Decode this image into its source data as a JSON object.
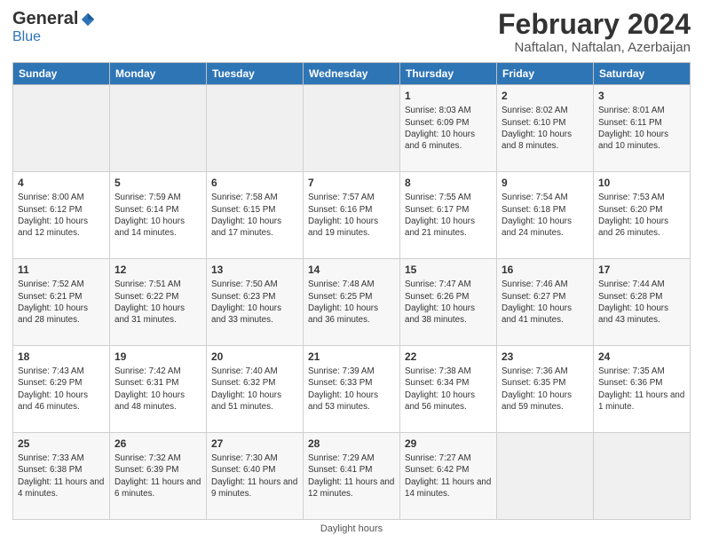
{
  "logo": {
    "general": "General",
    "blue": "Blue"
  },
  "header": {
    "month_year": "February 2024",
    "location": "Naftalan, Naftalan, Azerbaijan"
  },
  "days_of_week": [
    "Sunday",
    "Monday",
    "Tuesday",
    "Wednesday",
    "Thursday",
    "Friday",
    "Saturday"
  ],
  "footer": {
    "label": "Daylight hours"
  },
  "weeks": [
    [
      {
        "day": "",
        "info": ""
      },
      {
        "day": "",
        "info": ""
      },
      {
        "day": "",
        "info": ""
      },
      {
        "day": "",
        "info": ""
      },
      {
        "day": "1",
        "info": "Sunrise: 8:03 AM\nSunset: 6:09 PM\nDaylight: 10 hours and 6 minutes."
      },
      {
        "day": "2",
        "info": "Sunrise: 8:02 AM\nSunset: 6:10 PM\nDaylight: 10 hours and 8 minutes."
      },
      {
        "day": "3",
        "info": "Sunrise: 8:01 AM\nSunset: 6:11 PM\nDaylight: 10 hours and 10 minutes."
      }
    ],
    [
      {
        "day": "4",
        "info": "Sunrise: 8:00 AM\nSunset: 6:12 PM\nDaylight: 10 hours and 12 minutes."
      },
      {
        "day": "5",
        "info": "Sunrise: 7:59 AM\nSunset: 6:14 PM\nDaylight: 10 hours and 14 minutes."
      },
      {
        "day": "6",
        "info": "Sunrise: 7:58 AM\nSunset: 6:15 PM\nDaylight: 10 hours and 17 minutes."
      },
      {
        "day": "7",
        "info": "Sunrise: 7:57 AM\nSunset: 6:16 PM\nDaylight: 10 hours and 19 minutes."
      },
      {
        "day": "8",
        "info": "Sunrise: 7:55 AM\nSunset: 6:17 PM\nDaylight: 10 hours and 21 minutes."
      },
      {
        "day": "9",
        "info": "Sunrise: 7:54 AM\nSunset: 6:18 PM\nDaylight: 10 hours and 24 minutes."
      },
      {
        "day": "10",
        "info": "Sunrise: 7:53 AM\nSunset: 6:20 PM\nDaylight: 10 hours and 26 minutes."
      }
    ],
    [
      {
        "day": "11",
        "info": "Sunrise: 7:52 AM\nSunset: 6:21 PM\nDaylight: 10 hours and 28 minutes."
      },
      {
        "day": "12",
        "info": "Sunrise: 7:51 AM\nSunset: 6:22 PM\nDaylight: 10 hours and 31 minutes."
      },
      {
        "day": "13",
        "info": "Sunrise: 7:50 AM\nSunset: 6:23 PM\nDaylight: 10 hours and 33 minutes."
      },
      {
        "day": "14",
        "info": "Sunrise: 7:48 AM\nSunset: 6:25 PM\nDaylight: 10 hours and 36 minutes."
      },
      {
        "day": "15",
        "info": "Sunrise: 7:47 AM\nSunset: 6:26 PM\nDaylight: 10 hours and 38 minutes."
      },
      {
        "day": "16",
        "info": "Sunrise: 7:46 AM\nSunset: 6:27 PM\nDaylight: 10 hours and 41 minutes."
      },
      {
        "day": "17",
        "info": "Sunrise: 7:44 AM\nSunset: 6:28 PM\nDaylight: 10 hours and 43 minutes."
      }
    ],
    [
      {
        "day": "18",
        "info": "Sunrise: 7:43 AM\nSunset: 6:29 PM\nDaylight: 10 hours and 46 minutes."
      },
      {
        "day": "19",
        "info": "Sunrise: 7:42 AM\nSunset: 6:31 PM\nDaylight: 10 hours and 48 minutes."
      },
      {
        "day": "20",
        "info": "Sunrise: 7:40 AM\nSunset: 6:32 PM\nDaylight: 10 hours and 51 minutes."
      },
      {
        "day": "21",
        "info": "Sunrise: 7:39 AM\nSunset: 6:33 PM\nDaylight: 10 hours and 53 minutes."
      },
      {
        "day": "22",
        "info": "Sunrise: 7:38 AM\nSunset: 6:34 PM\nDaylight: 10 hours and 56 minutes."
      },
      {
        "day": "23",
        "info": "Sunrise: 7:36 AM\nSunset: 6:35 PM\nDaylight: 10 hours and 59 minutes."
      },
      {
        "day": "24",
        "info": "Sunrise: 7:35 AM\nSunset: 6:36 PM\nDaylight: 11 hours and 1 minute."
      }
    ],
    [
      {
        "day": "25",
        "info": "Sunrise: 7:33 AM\nSunset: 6:38 PM\nDaylight: 11 hours and 4 minutes."
      },
      {
        "day": "26",
        "info": "Sunrise: 7:32 AM\nSunset: 6:39 PM\nDaylight: 11 hours and 6 minutes."
      },
      {
        "day": "27",
        "info": "Sunrise: 7:30 AM\nSunset: 6:40 PM\nDaylight: 11 hours and 9 minutes."
      },
      {
        "day": "28",
        "info": "Sunrise: 7:29 AM\nSunset: 6:41 PM\nDaylight: 11 hours and 12 minutes."
      },
      {
        "day": "29",
        "info": "Sunrise: 7:27 AM\nSunset: 6:42 PM\nDaylight: 11 hours and 14 minutes."
      },
      {
        "day": "",
        "info": ""
      },
      {
        "day": "",
        "info": ""
      }
    ]
  ]
}
